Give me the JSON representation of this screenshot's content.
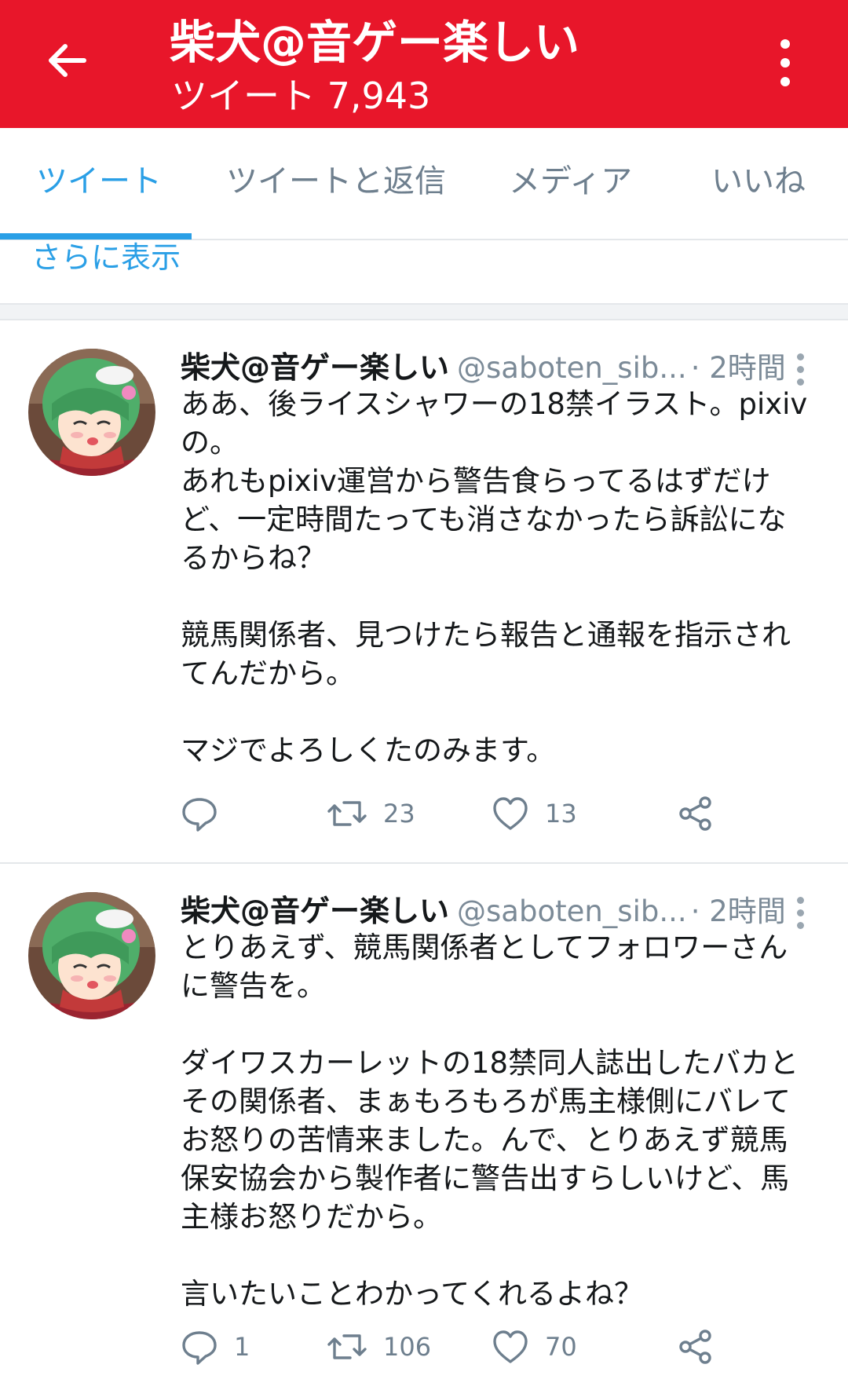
{
  "header": {
    "title": "柴犬@音ゲー楽しい",
    "subtitle": "ツイート 7,943",
    "back_icon": "arrow-left-icon",
    "menu_icon": "more-vertical-icon",
    "background_color": "#e8162a"
  },
  "tabs": [
    {
      "label": "ツイート",
      "active": true
    },
    {
      "label": "ツイートと返信",
      "active": false
    },
    {
      "label": "メディア",
      "active": false
    },
    {
      "label": "いいね",
      "active": false
    }
  ],
  "show_more": "さらに表示",
  "accent_color": "#2a9fe6",
  "tweets": [
    {
      "author_name": "柴犬@音ゲー楽しい",
      "handle": "@saboten_sib...",
      "time": "· 2時間",
      "body": "ああ、後ライスシャワーの18禁イラスト。pixivの。\nあれもpixiv運営から警告食らってるはずだけど、一定時間たっても消さなかったら訴訟になるからね？\n\n競馬関係者、見つけたら報告と通報を指示されてんだから。\n\nマジでよろしくたのみます。",
      "reply_count": "",
      "retweet_count": "23",
      "like_count": "13"
    },
    {
      "author_name": "柴犬@音ゲー楽しい",
      "handle": "@saboten_sib...",
      "time": "· 2時間",
      "body": "とりあえず、競馬関係者としてフォロワーさんに警告を。\n\nダイワスカーレットの18禁同人誌出したバカとその関係者、まぁもろもろが馬主様側にバレてお怒りの苦情来ました。んで、とりあえず競馬保安協会から製作者に警告出すらしいけど、馬主様お怒りだから。\n\n言いたいことわかってくれるよね？",
      "reply_count": "1",
      "retweet_count": "106",
      "like_count": "70"
    }
  ]
}
